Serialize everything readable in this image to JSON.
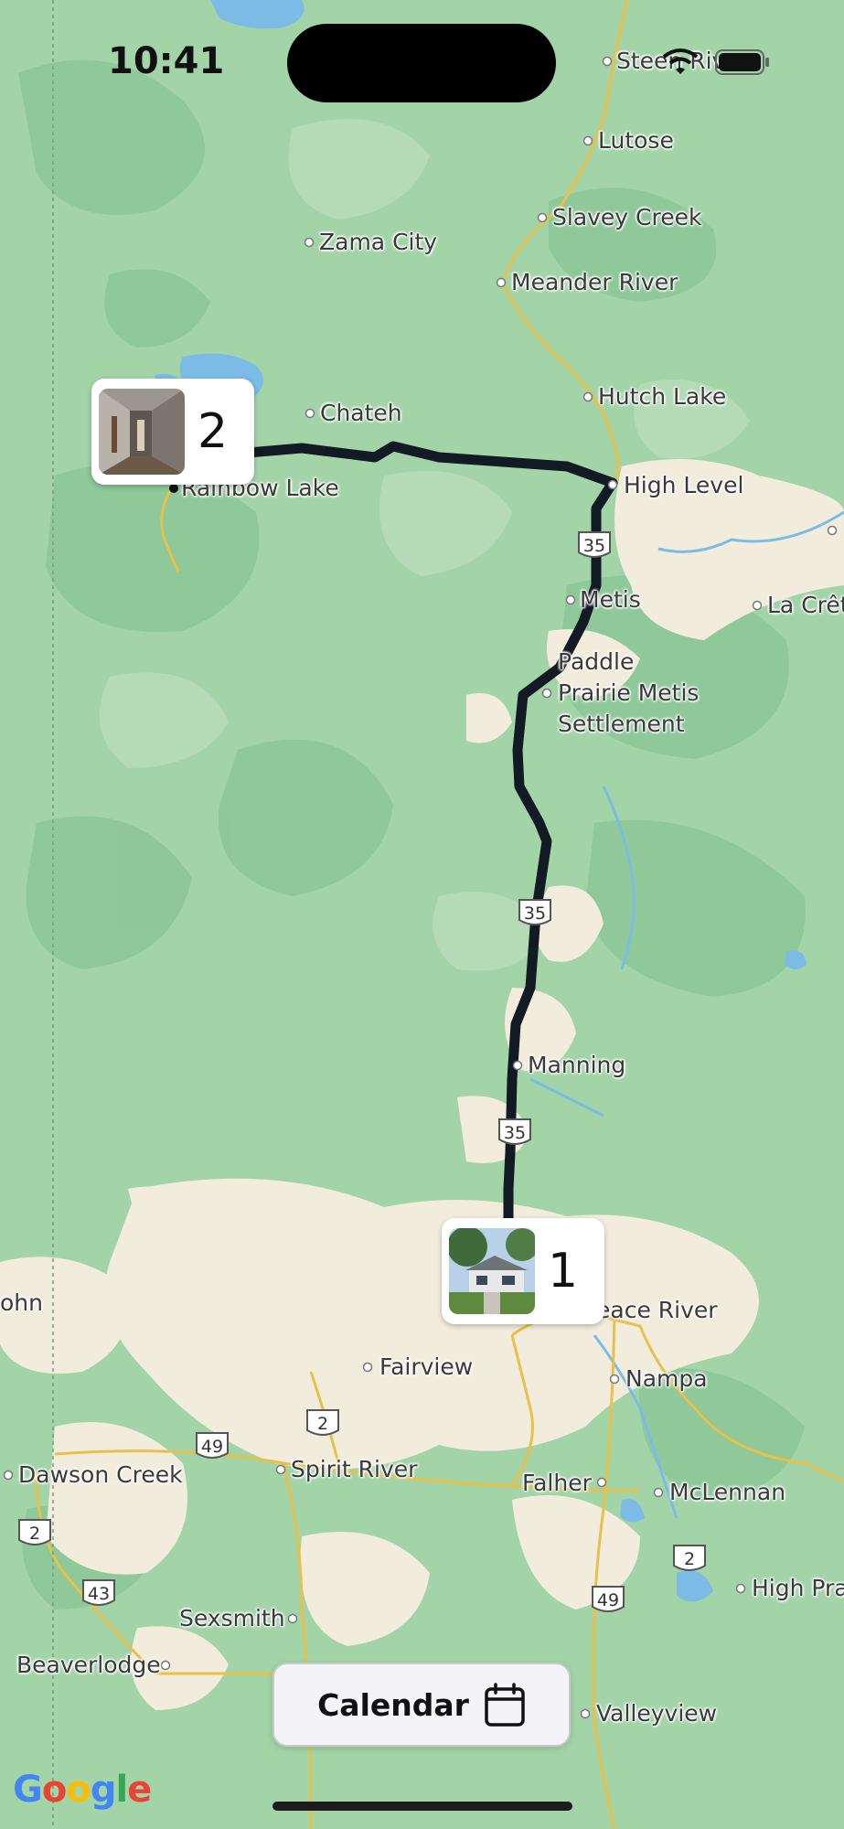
{
  "status_bar": {
    "time": "10:41"
  },
  "places": [
    {
      "id": "steen-river",
      "name": "Steen Riv"
    },
    {
      "id": "lutose",
      "name": "Lutose"
    },
    {
      "id": "slavey-creek",
      "name": "Slavey Creek"
    },
    {
      "id": "zama-city",
      "name": "Zama City"
    },
    {
      "id": "meander-river",
      "name": "Meander River"
    },
    {
      "id": "hutch-lake",
      "name": "Hutch Lake"
    },
    {
      "id": "chateh",
      "name": "Chateh"
    },
    {
      "id": "rainbow-lake",
      "name": "Rainbow Lake"
    },
    {
      "id": "high-level",
      "name": "High Level"
    },
    {
      "id": "metis",
      "name": "Metis"
    },
    {
      "id": "la-crete",
      "name": "La Crêt"
    },
    {
      "id": "paddle",
      "name": "Paddle"
    },
    {
      "id": "prairie-metis",
      "name": "Prairie Metis"
    },
    {
      "id": "settlement",
      "name": "Settlement"
    },
    {
      "id": "manning",
      "name": "Manning"
    },
    {
      "id": "peace-river",
      "name": "eace River"
    },
    {
      "id": "john",
      "name": "ohn"
    },
    {
      "id": "fairview",
      "name": "Fairview"
    },
    {
      "id": "nampa",
      "name": "Nampa"
    },
    {
      "id": "dawson-creek",
      "name": "Dawson Creek"
    },
    {
      "id": "spirit-river",
      "name": "Spirit River"
    },
    {
      "id": "falher",
      "name": "Falher"
    },
    {
      "id": "mclennan",
      "name": "McLennan"
    },
    {
      "id": "high-prairie",
      "name": "High Pra"
    },
    {
      "id": "sexsmith",
      "name": "Sexsmith"
    },
    {
      "id": "beaverlodge",
      "name": "Beaverlodge"
    },
    {
      "id": "valleyview",
      "name": "Valleyview"
    }
  ],
  "highway_shields": [
    "35",
    "35",
    "35",
    "49",
    "2",
    "2",
    "43",
    "2",
    "49"
  ],
  "markers": [
    {
      "id": "stop-2",
      "number": "2"
    },
    {
      "id": "stop-1",
      "number": "1"
    }
  ],
  "route": {
    "color": "#121a24"
  },
  "calendar_button": {
    "label": "Calendar",
    "icon": "calendar-icon"
  },
  "attribution": {
    "text": "Google"
  }
}
